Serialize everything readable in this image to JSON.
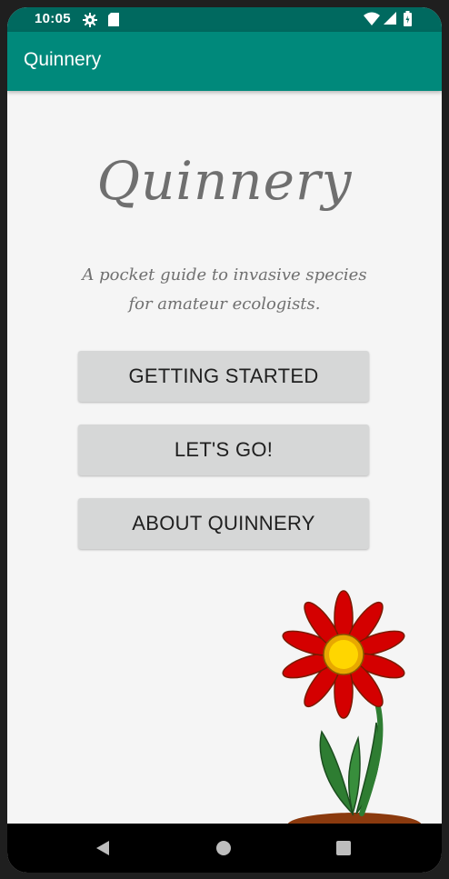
{
  "status_bar": {
    "time": "10:05",
    "icons": [
      "gear-icon",
      "sd-card-icon",
      "wifi-icon",
      "signal-icon",
      "battery-icon"
    ]
  },
  "app_bar": {
    "title": "Quinnery"
  },
  "main": {
    "hero_title": "Quinnery",
    "tagline_line1": "A pocket guide to invasive species",
    "tagline_line2": "for amateur ecologists.",
    "buttons": [
      {
        "label": "GETTING STARTED"
      },
      {
        "label": "LET'S GO!"
      },
      {
        "label": "ABOUT QUINNERY"
      }
    ],
    "illustration": "flower-illustration"
  },
  "nav_bar": {
    "icons": [
      "back-icon",
      "home-icon",
      "recents-icon"
    ]
  },
  "colors": {
    "status_bar": "#00695f",
    "app_bar": "#00897b",
    "background": "#f5f5f5",
    "button": "#d6d7d7",
    "petal": "#d40000",
    "flower_center": "#f5c400",
    "stem": "#2e7d32",
    "soil": "#8b3a0e"
  }
}
